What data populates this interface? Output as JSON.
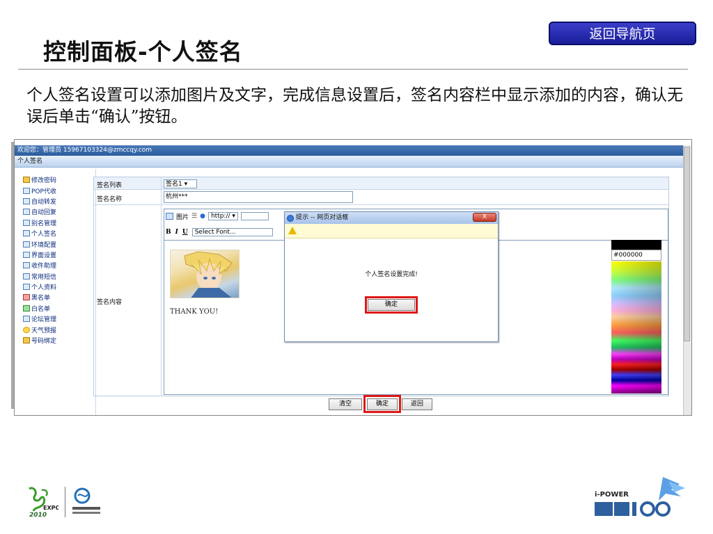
{
  "slide": {
    "title": "控制面板-个人签名",
    "nav_button": "返回导航页",
    "description": "个人签名设置可以添加图片及文字，完成信息设置后，签名内容栏中显示添加的内容，确认无误后单击“确认”按钮。"
  },
  "screenshot": {
    "welcome": "欢迎您：管理员 15967103324@zmccqy.com",
    "page_label": "个人签名",
    "sidebar": [
      {
        "label": "修改密码",
        "icon": "key-icon"
      },
      {
        "label": "POP代收",
        "icon": "mailbox-icon"
      },
      {
        "label": "自动转发",
        "icon": "forward-icon"
      },
      {
        "label": "自动回复",
        "icon": "reply-icon"
      },
      {
        "label": "别名管理",
        "icon": "alias-icon"
      },
      {
        "label": "个人签名",
        "icon": "signature-icon"
      },
      {
        "label": "环境配置",
        "icon": "settings-icon"
      },
      {
        "label": "界面设置",
        "icon": "interface-icon"
      },
      {
        "label": "收件助理",
        "icon": "inbox-helper-icon"
      },
      {
        "label": "常用短信",
        "icon": "sms-icon"
      },
      {
        "label": "个人资料",
        "icon": "profile-icon"
      },
      {
        "label": "黑名单",
        "icon": "blacklist-icon"
      },
      {
        "label": "白名单",
        "icon": "whitelist-icon"
      },
      {
        "label": "论坛管理",
        "icon": "forum-icon"
      },
      {
        "label": "天气预报",
        "icon": "weather-icon"
      },
      {
        "label": "号码绑定",
        "icon": "phone-bind-icon"
      }
    ],
    "form": {
      "list_label": "签名列表",
      "list_value": "签名1",
      "name_label": "签名名称",
      "name_value": "杭州***",
      "content_label": "签名内容"
    },
    "editor": {
      "image_button": "图片",
      "url_value": "http://",
      "font_select": "Select Font...",
      "bold": "B",
      "italic": "I",
      "underline": "U",
      "body_text": "THANK YOU!"
    },
    "palette": {
      "hex_value": "#000000"
    },
    "dialog": {
      "title": "提示 -- 网页对话框",
      "close": "X",
      "message": "个人签名设置完成!",
      "ok_button": "确定"
    },
    "buttons": {
      "clear": "清空",
      "confirm": "确定",
      "back": "返回"
    }
  },
  "logos": {
    "expo_text": "EXPO",
    "power_text": "i-POWER"
  }
}
